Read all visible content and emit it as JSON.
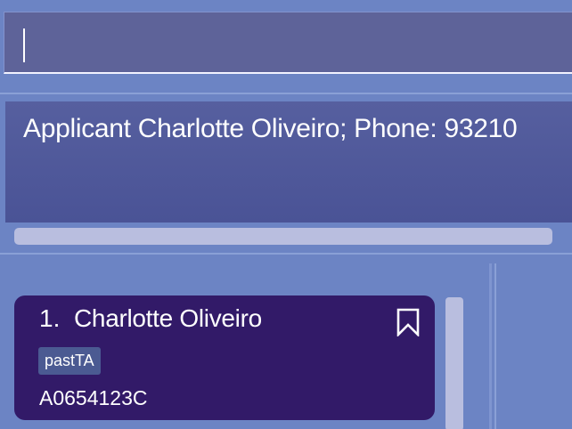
{
  "command": {
    "value": ""
  },
  "result": {
    "text": "Applicant Charlotte Oliveiro; Phone: 93210"
  },
  "applicants": [
    {
      "index": "1.",
      "name": "Charlotte Oliveiro",
      "tag": "pastTA",
      "id": "A0654123C",
      "bookmark_icon": "bookmark-icon"
    }
  ],
  "colors": {
    "background": "#6c84c4",
    "command_box": "#5e6399",
    "result_box": "#4a5396",
    "card": "#321a68",
    "tag": "#4b5a92",
    "scrollbar": "#b9bedf"
  }
}
